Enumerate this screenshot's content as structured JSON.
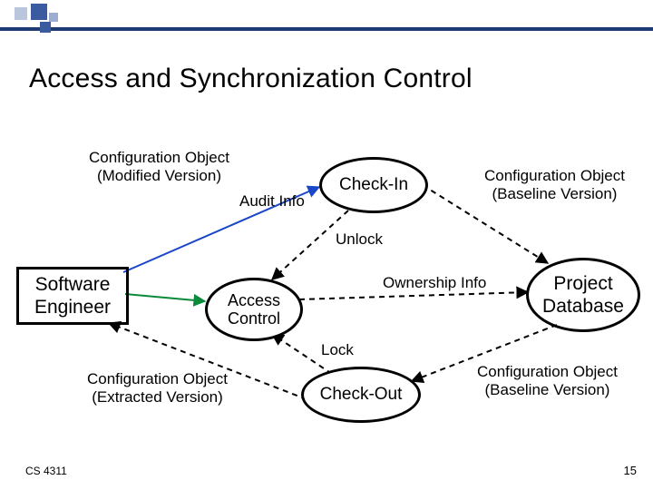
{
  "title": "Access and Synchronization Control",
  "footer": {
    "course": "CS 4311",
    "page": "15"
  },
  "nodes": {
    "software_engineer": "Software\nEngineer",
    "project_database": "Project\nDatabase",
    "check_in": "Check-In",
    "access_control": "Access\nControl",
    "check_out": "Check-Out"
  },
  "labels": {
    "config_modified": "Configuration Object\n(Modified Version)",
    "config_baseline_top": "Configuration Object\n(Baseline Version)",
    "audit_info": "Audit Info",
    "unlock": "Unlock",
    "ownership_info": "Ownership Info",
    "lock": "Lock",
    "config_extracted": "Configuration Object\n(Extracted Version)",
    "config_baseline_bottom": "Configuration Object\n(Baseline Version)"
  }
}
